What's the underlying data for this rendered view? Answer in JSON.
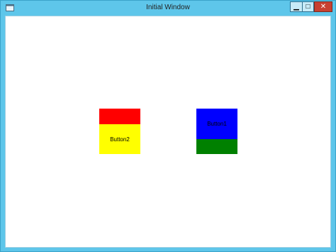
{
  "window": {
    "title": "Initial Window",
    "controls": {
      "minimize_glyph": "▁",
      "maximize_glyph": "□",
      "close_glyph": "✕"
    }
  },
  "left_stack": {
    "top_button": {
      "label": "",
      "color": "#ff0000"
    },
    "bottom_button": {
      "label": "Button2",
      "color": "#ffff00"
    }
  },
  "right_stack": {
    "top_button": {
      "label": "Button1",
      "color": "#0000ff"
    },
    "bottom_button": {
      "label": "",
      "color": "#008000"
    }
  },
  "colors": {
    "titlebar": "#5ec6ea",
    "close": "#c84031",
    "client": "#ffffff"
  }
}
